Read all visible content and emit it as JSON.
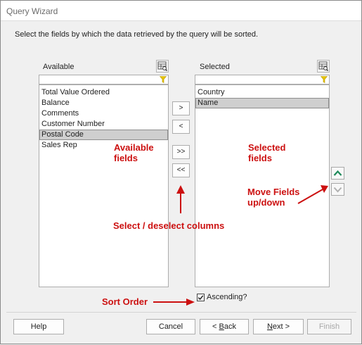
{
  "window": {
    "title": "Query Wizard"
  },
  "instructions": "Select the fields by which the data retrieved by the query will be sorted.",
  "available": {
    "label": "Available",
    "items": [
      "Total Value Ordered",
      "Balance",
      "Comments",
      "Customer Number",
      "Postal Code",
      "Sales Rep"
    ],
    "selected_index": 4
  },
  "selected": {
    "label": "Selected",
    "items": [
      "Country",
      "Name"
    ],
    "selected_index": 1
  },
  "move_buttons": {
    "add": ">",
    "remove": "<",
    "add_all": ">>",
    "remove_all": "<<"
  },
  "annotations": {
    "available_fields": [
      "Available",
      "fields"
    ],
    "selected_fields": [
      "Selected",
      "fields"
    ],
    "move_fields": [
      "Move Fields",
      "up/down"
    ],
    "select_deselect": "Select / deselect columns",
    "sort_order": "Sort Order"
  },
  "ascending": {
    "label": "Ascending?",
    "checked": true
  },
  "footer": {
    "help": "Help",
    "cancel": "Cancel",
    "back_prefix": "< ",
    "back_key": "B",
    "back_rest": "ack",
    "next_key": "N",
    "next_rest": "ext >",
    "finish": "Finish"
  },
  "colors": {
    "annotation": "#cc1010",
    "accent_green": "#1e8a5a",
    "filter_yellow": "#e8c400",
    "selection": "#cfcfcf"
  },
  "icons": {
    "list_options": "table-options-icon",
    "filter": "funnel-icon",
    "move_up": "chevron-up-icon",
    "move_down": "chevron-down-icon"
  }
}
